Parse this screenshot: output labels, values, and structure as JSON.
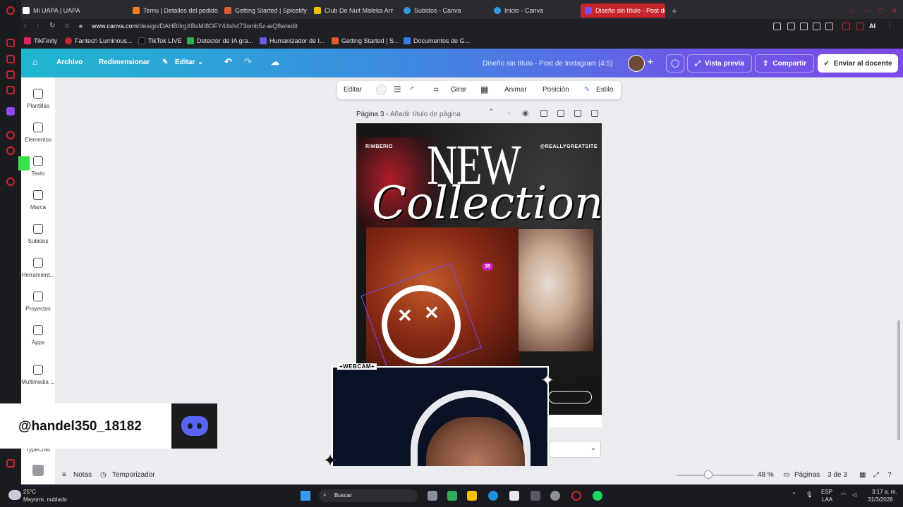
{
  "browser": {
    "tabs": [
      {
        "label": "Mi UAPA | UAPA",
        "color": "#e6e6ea"
      },
      {
        "label": "Temu | Detalles del pedido",
        "color": "#f47b20"
      },
      {
        "label": "Getting Started | Spicetify",
        "color": "#e05a2b"
      },
      {
        "label": "Club De Nuit Maleka Arme",
        "color": "#f2c200"
      },
      {
        "label": "Subidos - Canva",
        "color": "#2f9be8"
      },
      {
        "label": "Inicio - Canva",
        "color": "#2f9be8"
      },
      {
        "label": "Diseño sin título - Post de",
        "color": "#7d4be8",
        "active": true
      }
    ],
    "url_host": "www.canva.com",
    "url_path": "/design/DAHB0rgXBsM/8OFY44sh473omb5z-aiQ8w/edit",
    "bookmarks": [
      {
        "label": "TikFinity",
        "color": "#e0245e"
      },
      {
        "label": "Fantech Luminous...",
        "color": "#c8262e"
      },
      {
        "label": "TikTok LIVE",
        "color": "#111111"
      },
      {
        "label": "Detector de IA gra...",
        "color": "#2fae57"
      },
      {
        "label": "Humanizador de I...",
        "color": "#6a5be6"
      },
      {
        "label": "Getting Started | S...",
        "color": "#e05a2b"
      },
      {
        "label": "Documentos de G...",
        "color": "#3b7de8"
      }
    ],
    "ai_label": "AI"
  },
  "canva_header": {
    "archivo": "Archivo",
    "redimensionar": "Redimensionar",
    "editar": "Editar",
    "design_title": "Diseño sin título - Post de Instagram (4:5)",
    "vista_previa": "Vista previa",
    "compartir": "Compartir",
    "enviar": "Enviar al docente"
  },
  "sidebar": {
    "items": [
      {
        "label": "Plantillas"
      },
      {
        "label": "Elementos"
      },
      {
        "label": "Texto"
      },
      {
        "label": "Marca"
      },
      {
        "label": "Subidos"
      },
      {
        "label": "Herramient..."
      },
      {
        "label": "Proyectos"
      },
      {
        "label": "Apps"
      },
      {
        "label": "Multimedia ..."
      },
      {
        "label": "TypeCraft"
      }
    ]
  },
  "context_toolbar": {
    "editar": "Editar",
    "girar": "Girar",
    "animar": "Animar",
    "posicion": "Posición",
    "estilo": "Estilo"
  },
  "page": {
    "label": "Página 3 -",
    "title_placeholder": "Añadir título de página"
  },
  "poster": {
    "top_left": "RIMBERIO",
    "top_right": "@REALLYGREATSITE",
    "headline": "NEW",
    "script": "Collection",
    "badge": "38"
  },
  "webcam": {
    "tag": "+WEBCAM+"
  },
  "overlay": {
    "handle": "@handel350_18182"
  },
  "bottom_bar": {
    "notas": "Notas",
    "temporizador": "Temporizador",
    "zoom": "48 %",
    "paginas": "Páginas",
    "page_count": "3 de 3"
  },
  "taskbar": {
    "temperature": "25°C",
    "weather": "Mayorm. nublado",
    "search": "Buscar",
    "lang1": "ESP",
    "lang2": "LAA",
    "time": "3:17 a. m.",
    "date": "31/3/2026"
  }
}
